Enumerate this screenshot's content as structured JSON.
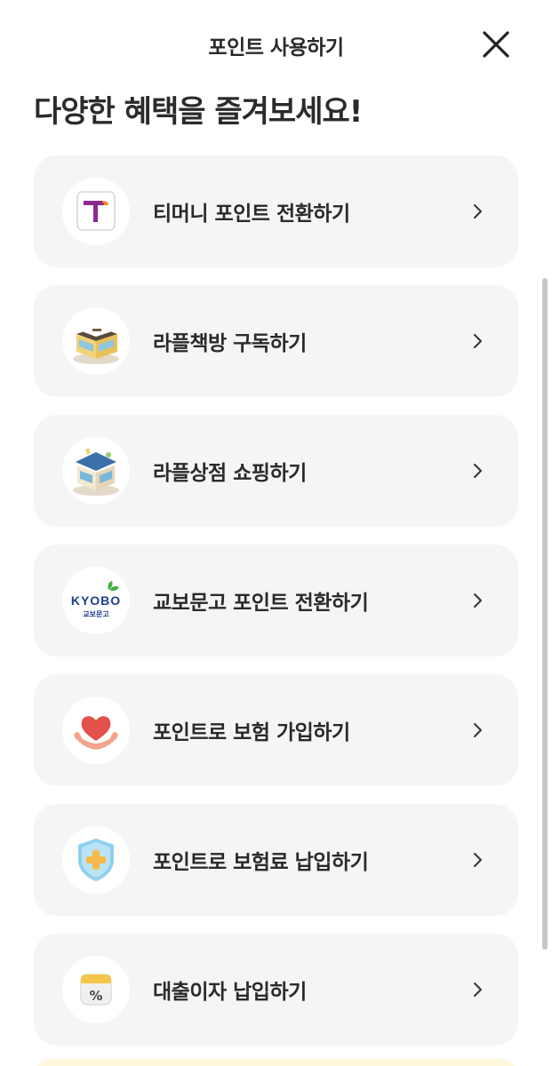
{
  "header": {
    "title": "포인트 사용하기",
    "close_icon": "close-icon"
  },
  "headline": "다양한 혜택을 즐겨보세요!",
  "menu": {
    "items": [
      {
        "label": "티머니 포인트 전환하기",
        "icon": "tmoney-logo-icon"
      },
      {
        "label": "라플책방 구독하기",
        "icon": "bookstore-building-icon"
      },
      {
        "label": "라플상점 쇼핑하기",
        "icon": "shop-building-icon"
      },
      {
        "label": "교보문고 포인트 전환하기",
        "icon": "kyobo-logo-icon",
        "logo_text": "KYOBO",
        "logo_subtext": "교보문고"
      },
      {
        "label": "포인트로 보험 가입하기",
        "icon": "heart-hands-icon"
      },
      {
        "label": "포인트로 보험료 납입하기",
        "icon": "shield-plus-icon"
      },
      {
        "label": "대출이자 납입하기",
        "icon": "percent-calendar-icon",
        "icon_text": "%"
      }
    ]
  },
  "colors": {
    "card_bg": "#f5f5f5",
    "tmoney_purple": "#8a2a8f",
    "tmoney_orange": "#f28a1f",
    "kyobo_navy": "#1f3f8f",
    "kyobo_green": "#3cae3c",
    "heart_red": "#e0524a",
    "shield_blue": "#8fd0ee",
    "shield_cross": "#f5b84a"
  }
}
